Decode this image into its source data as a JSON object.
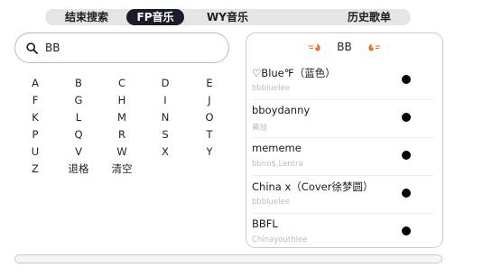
{
  "tabs": [
    "结束搜索",
    "FP音乐",
    "WY音乐",
    "历史歌单"
  ],
  "search": {
    "icon": "search-icon",
    "value": "BB"
  },
  "keyboard": [
    [
      "A",
      "B",
      "C",
      "D",
      "E"
    ],
    [
      "F",
      "G",
      "H",
      "I",
      "J"
    ],
    [
      "K",
      "L",
      "M",
      "N",
      "O"
    ],
    [
      "P",
      "Q",
      "R",
      "S",
      "T"
    ],
    [
      "U",
      "V",
      "W",
      "X",
      "Y"
    ],
    [
      "Z",
      "退格",
      "清空"
    ]
  ],
  "results": {
    "query": "BB",
    "header_icons": [
      "flame-icon",
      "flame-icon"
    ],
    "accent_color": "#f2651d",
    "items": [
      {
        "title": "♡Blue℉（蓝色）",
        "artist": "bbbluelee"
      },
      {
        "title": "bboydanny",
        "artist": "黄旭"
      },
      {
        "title": "mememe",
        "artist": "bbno$,Lentra"
      },
      {
        "title": "China x（Cover徐梦圆）",
        "artist": "bbbluelee"
      },
      {
        "title": "BBFL",
        "artist": "Chinayouthlee"
      }
    ]
  }
}
